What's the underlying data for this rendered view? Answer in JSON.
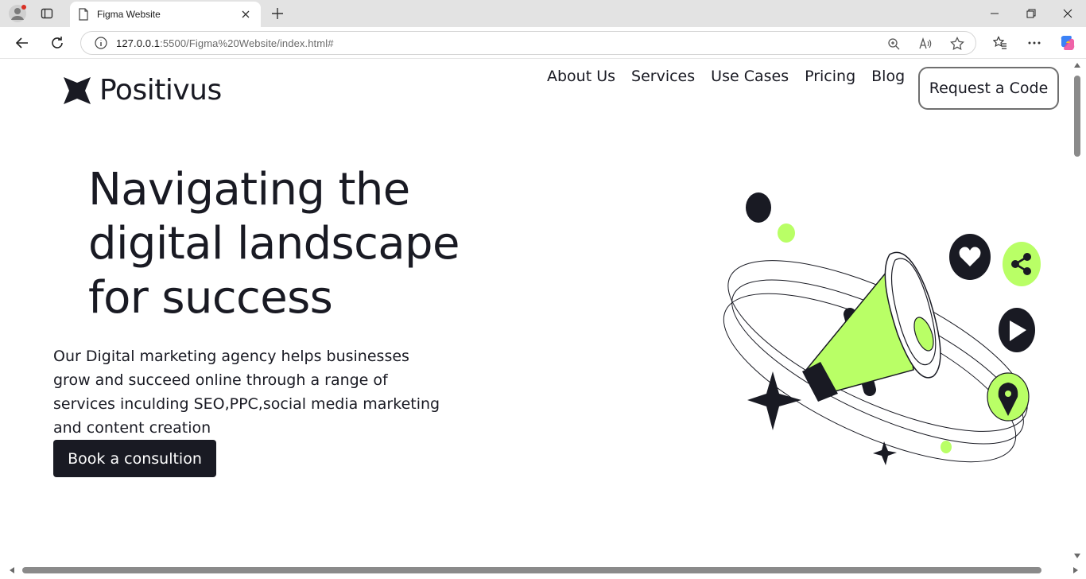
{
  "browser": {
    "tab_title": "Figma Website",
    "url_host": "127.0.0.1",
    "url_rest": ":5500/Figma%20Website/index.html#"
  },
  "site": {
    "logo": "Positivus",
    "nav": [
      "About Us",
      "Services",
      "Use Cases",
      "Pricing",
      "Blog"
    ],
    "cta": "Request a Code",
    "hero": {
      "headline": "Navigating the digital landscape for success",
      "description": "Our Digital marketing agency helps businesses grow and succeed online through a range of services inculding SEO,PPC,social media marketing and content creation",
      "button": "Book a consultion"
    },
    "accent_color": "#B9FF66",
    "dark_color": "#191A23"
  }
}
